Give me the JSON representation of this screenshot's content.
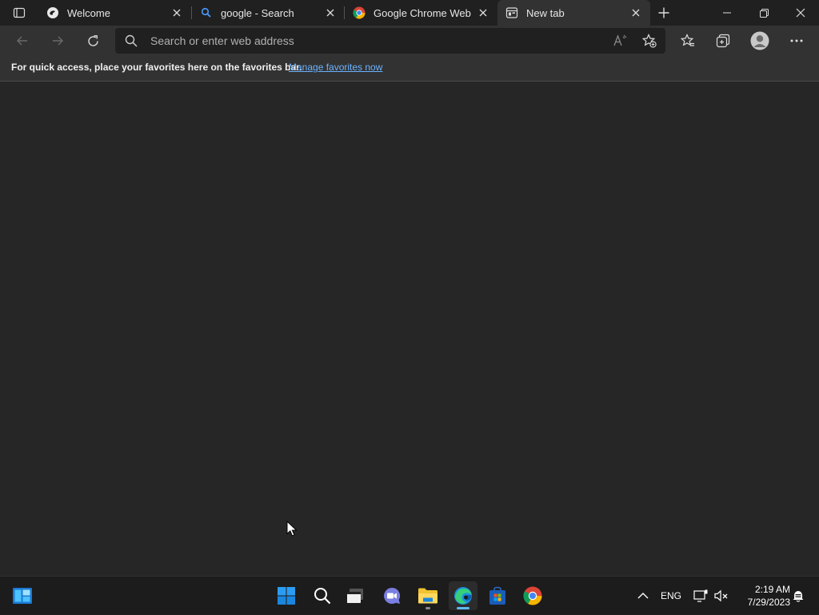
{
  "browser": {
    "tabs": [
      {
        "title": "Welcome",
        "icon": "edge-logo-icon"
      },
      {
        "title": "google - Search",
        "icon": "search-icon"
      },
      {
        "title": "Google Chrome Web Browser",
        "icon": "chrome-logo-icon"
      },
      {
        "title": "New tab",
        "icon": "new-tab-page-icon",
        "active": true
      }
    ],
    "address_bar": {
      "placeholder": "Search or enter web address",
      "value": ""
    },
    "favorites_bar": {
      "message": "For quick access, place your favorites here on the favorites bar.",
      "link": "Manage favorites now"
    }
  },
  "taskbar": {
    "pinned": [
      "widgets-icon",
      "start-icon",
      "search-icon",
      "task-view-icon",
      "chat-icon",
      "file-explorer-icon",
      "edge-icon",
      "store-icon",
      "chrome-icon"
    ],
    "language": "ENG",
    "time": "2:19 AM",
    "date": "7/29/2023"
  },
  "colors": {
    "background": "#262626",
    "tabstrip": "#202020",
    "toolbar": "#323232",
    "link": "#6cb3ff",
    "taskbar": "#1c1c1c"
  }
}
